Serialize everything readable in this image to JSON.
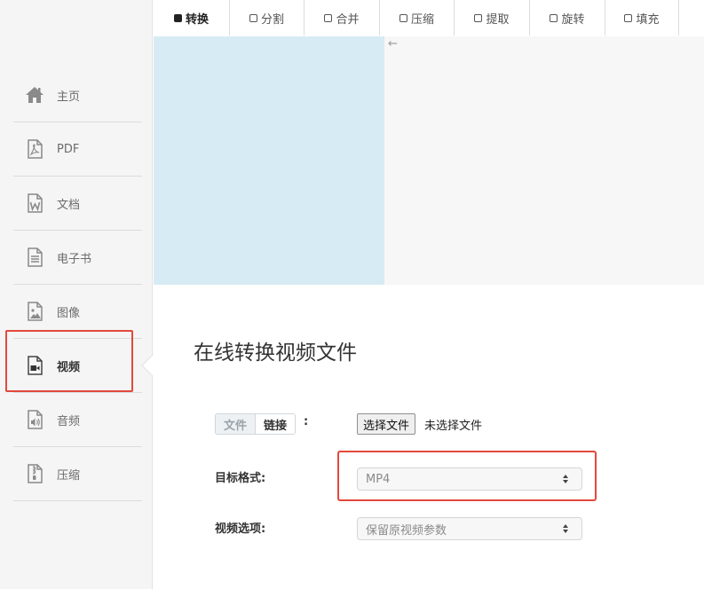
{
  "sidebar": {
    "items": [
      {
        "label": "主页",
        "icon": "home-icon"
      },
      {
        "label": "PDF",
        "icon": "pdf-file-icon"
      },
      {
        "label": "文档",
        "icon": "word-file-icon"
      },
      {
        "label": "电子书",
        "icon": "ebook-file-icon"
      },
      {
        "label": "图像",
        "icon": "image-file-icon"
      },
      {
        "label": "视频",
        "icon": "video-file-icon",
        "active": true
      },
      {
        "label": "音频",
        "icon": "audio-file-icon"
      },
      {
        "label": "压缩",
        "icon": "archive-file-icon"
      }
    ]
  },
  "tabs": [
    {
      "label": "转换",
      "active": true
    },
    {
      "label": "分割"
    },
    {
      "label": "合并"
    },
    {
      "label": "压缩"
    },
    {
      "label": "提取"
    },
    {
      "label": "旋转"
    },
    {
      "label": "填充"
    }
  ],
  "main": {
    "title": "在线转换视频文件",
    "source": {
      "file_label": "文件",
      "link_label": "链接",
      "colon": ":"
    },
    "file_input": {
      "button_label": "选择文件",
      "status": "未选择文件"
    },
    "target_format": {
      "label": "目标格式:",
      "value": "MP4"
    },
    "video_options": {
      "label": "视频选项:",
      "value": "保留原视频参数"
    }
  },
  "colors": {
    "highlight": "#e2493b",
    "banner": "#d7ebf4",
    "sidebar_bg": "#f5f5f5"
  }
}
